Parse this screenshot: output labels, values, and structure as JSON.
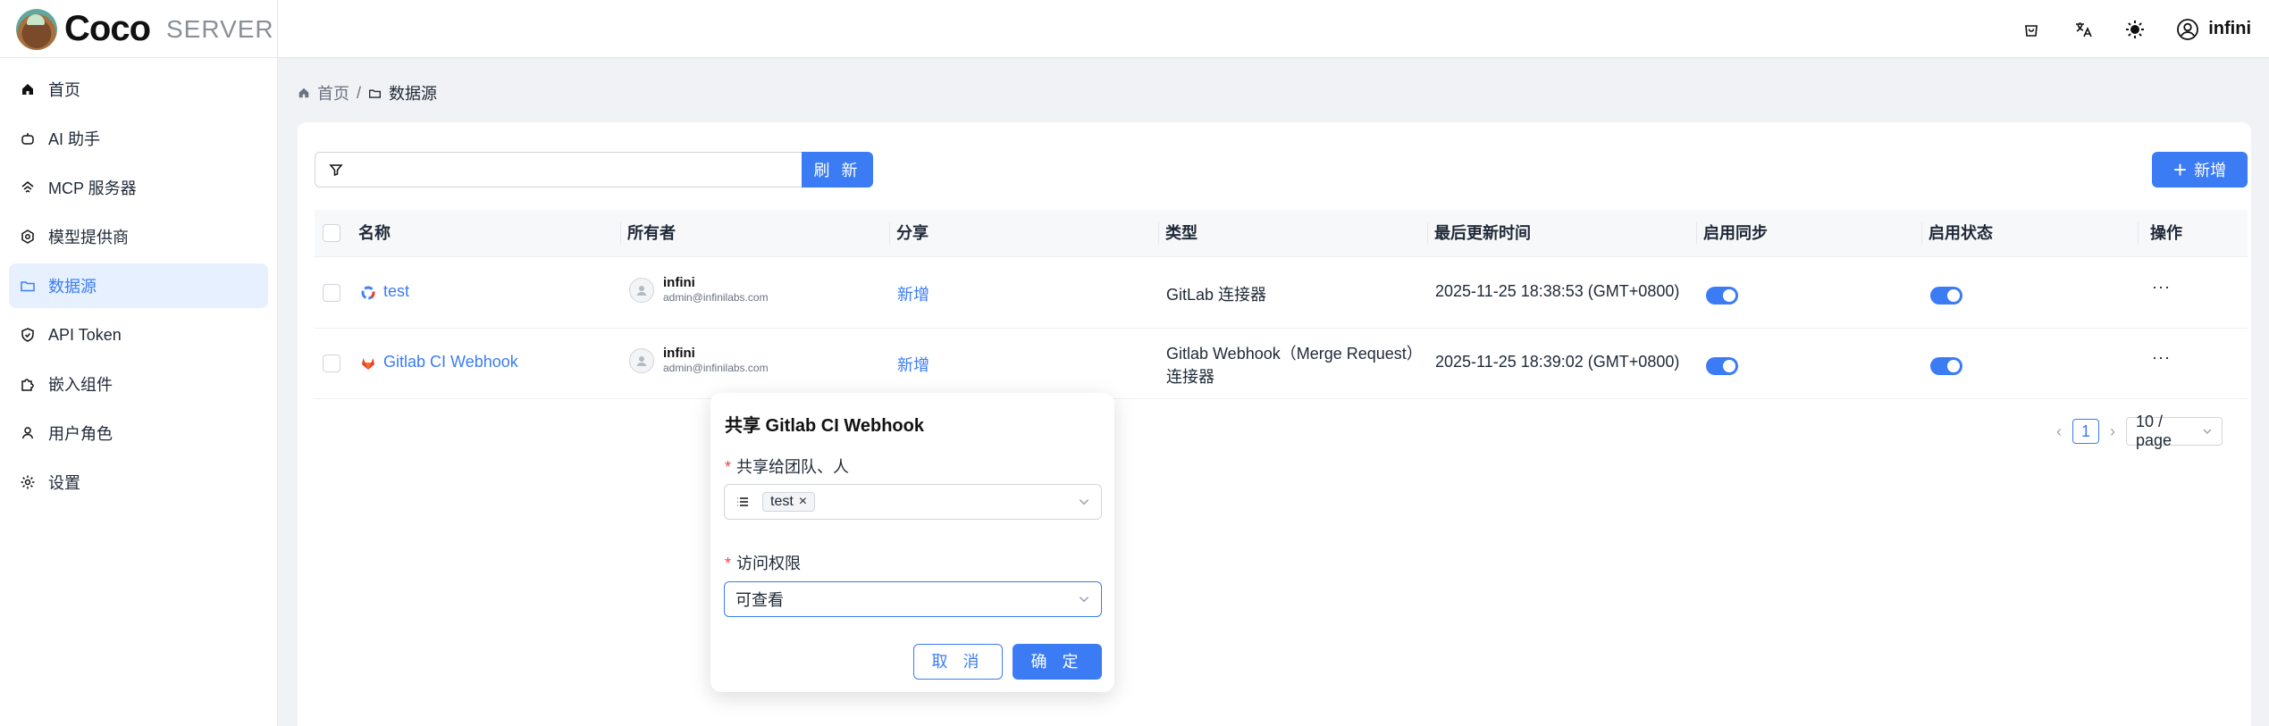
{
  "app": {
    "brand_name": "Coco",
    "brand_suffix": "SERVER"
  },
  "header": {
    "username": "infini"
  },
  "sidebar": {
    "items": [
      {
        "label": "首页",
        "icon": "home-icon"
      },
      {
        "label": "AI 助手",
        "icon": "robot-icon"
      },
      {
        "label": "MCP 服务器",
        "icon": "mcp-icon"
      },
      {
        "label": "模型提供商",
        "icon": "model-icon"
      },
      {
        "label": "数据源",
        "icon": "folder-icon",
        "active": true
      },
      {
        "label": "API Token",
        "icon": "shield-icon"
      },
      {
        "label": "嵌入组件",
        "icon": "puzzle-icon"
      },
      {
        "label": "用户角色",
        "icon": "user-icon"
      },
      {
        "label": "设置",
        "icon": "gear-icon"
      }
    ]
  },
  "breadcrumb": {
    "home": "首页",
    "current": "数据源"
  },
  "toolbar": {
    "search_value": "",
    "refresh_label": "刷 新",
    "add_label": "新增"
  },
  "table": {
    "headers": [
      "名称",
      "所有者",
      "分享",
      "类型",
      "最后更新时间",
      "启用同步",
      "启用状态",
      "操作"
    ],
    "rows": [
      {
        "name": "test",
        "owner_name": "infini",
        "owner_email": "admin@infinilabs.com",
        "share": "新增",
        "type": "GitLab 连接器",
        "updated": "2025-11-25 18:38:53 (GMT+0800)",
        "sync": true,
        "enabled": true,
        "actions": "···"
      },
      {
        "name": "Gitlab CI Webhook",
        "owner_name": "infini",
        "owner_email": "admin@infinilabs.com",
        "share": "新增",
        "type_line1": "Gitlab Webhook（Merge Request）",
        "type_line2": "连接器",
        "updated": "2025-11-25 18:39:02 (GMT+0800)",
        "sync": true,
        "enabled": true,
        "actions": "···"
      }
    ]
  },
  "pagination": {
    "current_page": "1",
    "page_size": "10 / page"
  },
  "share_popover": {
    "title": "共享 Gitlab CI Webhook",
    "share_to_label": "共享给团队、人",
    "share_tag": "test",
    "permission_label": "访问权限",
    "permission_value": "可查看",
    "cancel_label": "取 消",
    "ok_label": "确 定"
  },
  "colors": {
    "accent": "#3b7cf4",
    "required": "#ef4444"
  }
}
